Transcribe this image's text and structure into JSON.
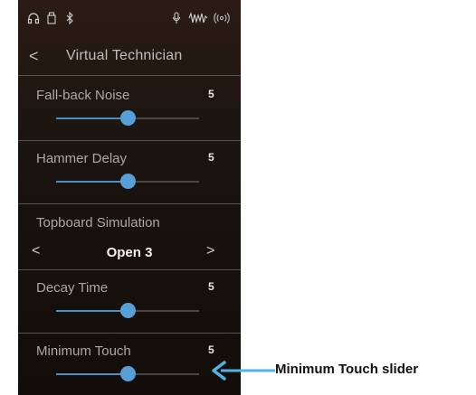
{
  "status_bar": {
    "icons": [
      "headphones-icon",
      "usb-memory-icon",
      "bluetooth-icon",
      "microphone-icon",
      "audio-waveform-icon",
      "wireless-icon"
    ]
  },
  "header": {
    "back_glyph": "<",
    "title": "Virtual Technician"
  },
  "settings": [
    {
      "label": "Fall-back Noise",
      "value": "5",
      "level_percent": 50
    },
    {
      "label": "Hammer Delay",
      "value": "5",
      "level_percent": 50
    },
    {
      "label": "Decay Time",
      "value": "5",
      "level_percent": 50
    },
    {
      "label": "Minimum Touch",
      "value": "5",
      "level_percent": 50
    }
  ],
  "topboard": {
    "label": "Topboard Simulation",
    "value": "Open 3",
    "prev_glyph": "<",
    "next_glyph": ">"
  },
  "annotation": {
    "label": "Minimum Touch slider",
    "color": "#4fb3e6"
  },
  "colors": {
    "slider_accent": "#56a0d7",
    "background": "#1b1410"
  }
}
